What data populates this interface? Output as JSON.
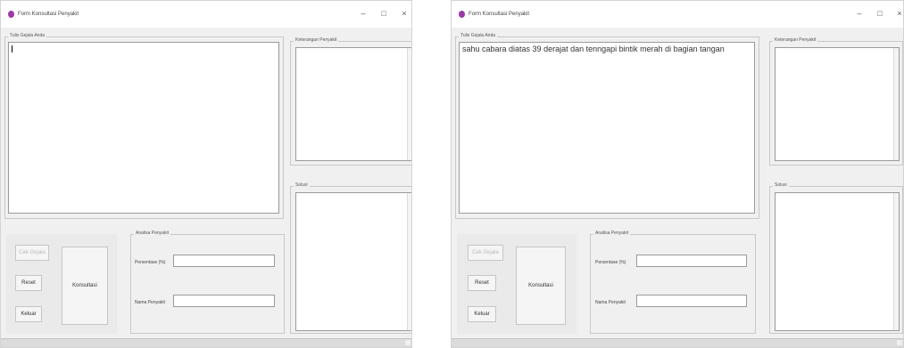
{
  "left_window": {
    "title": "Form Konsultasi Penyakit",
    "controls": {
      "minimize": "–",
      "maximize": "□",
      "close": "×"
    },
    "input_frame_label": "Tulis Gejala Anda",
    "input_text": "",
    "info_frame_label": "Keterangan Penyakit",
    "solution_frame_label": "Solusi",
    "buttons": {
      "proses": "Cek Gejala",
      "reset": "Reset",
      "keluar": "Keluar",
      "konsultasi": "Konsultasi"
    },
    "result_frame_label": "Analisa Penyakit",
    "label_percentage": "Persentase (%)",
    "label_disease": "Nama Penyakit"
  },
  "right_window": {
    "title": "Form Konsultasi Penyakit",
    "controls": {
      "minimize": "–",
      "maximize": "□",
      "close": "×"
    },
    "input_frame_label": "Tulis Gejala Anda",
    "input_text": "sahu cabara diatas 39 derajat dan tenngapi bintik merah di bagian tangan",
    "info_frame_label": "Keterangan Penyakit",
    "solution_frame_label": "Solusi",
    "buttons": {
      "proses": "Cek Gejala",
      "reset": "Reset",
      "keluar": "Keluar",
      "konsultasi": "Konsultasi"
    },
    "result_frame_label": "Analisa Penyakit",
    "label_percentage": "Persentase (%)",
    "label_disease": "Nama Penyakit"
  }
}
